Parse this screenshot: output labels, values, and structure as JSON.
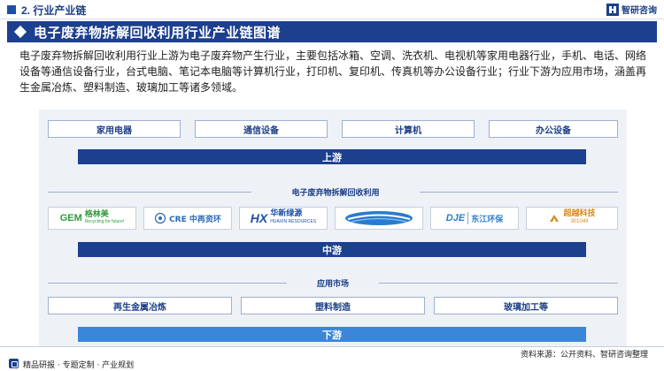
{
  "header": {
    "section_title": "2. 行业产业链",
    "brand_name": "智研咨询"
  },
  "title": "电子废弃物拆解回收利用行业产业链图谱",
  "intro": "电子废弃物拆解回收利用行业上游为电子废弃物产生行业，主要包括冰箱、空调、洗衣机、电视机等家用电器行业，手机、电话、网络设备等通信设备行业，台式电脑、笔记本电脑等计算机行业，打印机、复印机、传真机等办公设备行业；行业下游为应用市场，涵盖再生金属冶炼、塑料制造、玻璃加工等诸多领域。",
  "upstream": {
    "items": [
      "家用电器",
      "通信设备",
      "计算机",
      "办公设备"
    ],
    "label": "上游"
  },
  "midstream": {
    "group_label": "电子废弃物拆解回收利用",
    "logos": [
      {
        "mark": "GEM",
        "text": "格林美",
        "sub": "Recycling for future!",
        "color": "#2e9a3a"
      },
      {
        "mark": "◯",
        "text": "CRE 中再资环",
        "sub": "",
        "color": "#2a6bb5"
      },
      {
        "mark": "HX",
        "text": "华新绿源",
        "sub": "HUAXIN RESOURCES",
        "color": "#1c4fa8"
      },
      {
        "mark": "",
        "text": "",
        "sub": "",
        "color": "#2a7bd0"
      },
      {
        "mark": "DJE",
        "text": "东江环保",
        "sub": "",
        "color": "#2a7bd0"
      },
      {
        "mark": "",
        "text": "超越科技",
        "sub": "301049",
        "color": "#d68a1c"
      }
    ],
    "label": "中游"
  },
  "downstream": {
    "group_label": "应用市场",
    "items": [
      "再生金属冶炼",
      "塑料制造",
      "玻璃加工等"
    ],
    "label": "下游"
  },
  "footer": {
    "source": "资料来源：公开资料、智研咨询整理",
    "tagline": "精品研报 · 专题定制 · 产业规划"
  },
  "colors": {
    "navy": "#1c3f8e",
    "blue": "#3a86d8",
    "panel": "#eef1f6"
  }
}
